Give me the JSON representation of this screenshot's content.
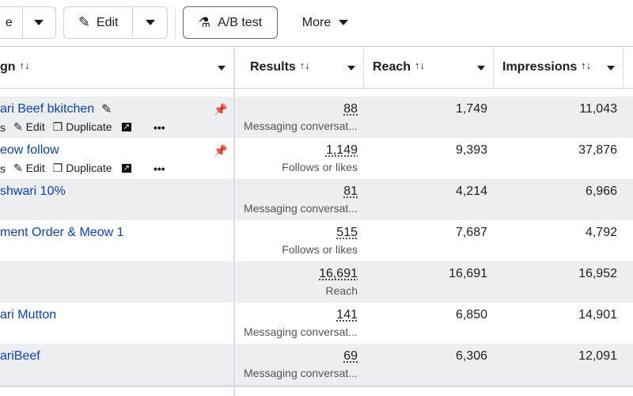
{
  "toolbar": {
    "first_button_label": "e",
    "edit_label": "Edit",
    "ab_test_label": "A/B test",
    "more_label": "More"
  },
  "table": {
    "headers": [
      "gn",
      "Results",
      "Reach",
      "Impressions"
    ],
    "actions": {
      "edit": "Edit",
      "duplicate": "Duplicate",
      "prefix": "s"
    },
    "rows": [
      {
        "name": "ari Beef bkitchen",
        "results": "88",
        "result_type": "Messaging conversat...",
        "reach": "1,749",
        "impressions": "11,043",
        "shaded": true,
        "has_actions": true
      },
      {
        "name": "eow follow",
        "results": "1,149",
        "result_type": "Follows or likes",
        "reach": "9,393",
        "impressions": "37,876",
        "shaded": false,
        "has_actions": true
      },
      {
        "name": "shwari 10%",
        "results": "81",
        "result_type": "Messaging conversat...",
        "reach": "4,214",
        "impressions": "6,966",
        "shaded": true
      },
      {
        "name": "ment Order & Meow 1",
        "results": "515",
        "result_type": "Follows or likes",
        "reach": "7,687",
        "impressions": "4,792",
        "shaded": false
      },
      {
        "name": "",
        "results": "16,691",
        "result_type": "Reach",
        "reach": "16,691",
        "impressions": "16,952",
        "shaded": true
      },
      {
        "name": "ari Mutton",
        "results": "141",
        "result_type": "Messaging conversat...",
        "reach": "6,850",
        "impressions": "14,901",
        "shaded": false
      },
      {
        "name": "ariBeef",
        "results": "69",
        "result_type": "Messaging conversat...",
        "reach": "6,306",
        "impressions": "12,091",
        "shaded": true
      }
    ]
  }
}
